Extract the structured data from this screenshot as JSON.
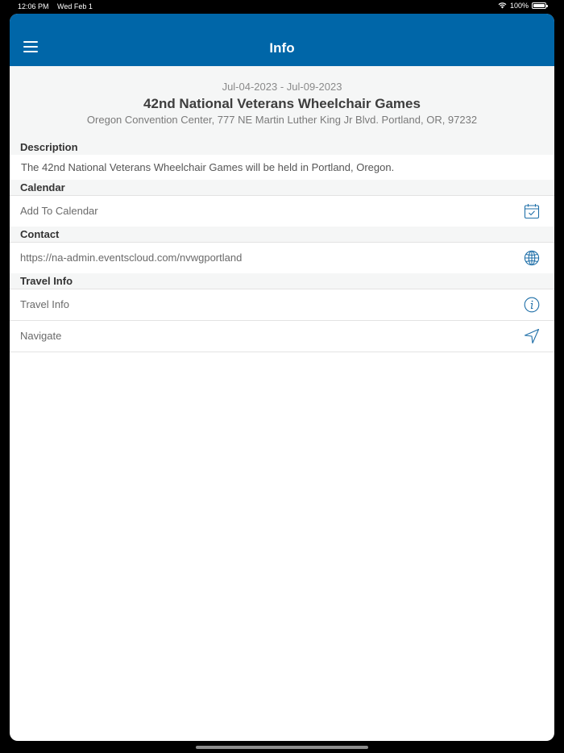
{
  "status_bar": {
    "time": "12:06 PM",
    "date": "Wed Feb 1",
    "battery": "100%"
  },
  "nav": {
    "title": "Info"
  },
  "event": {
    "dates": "Jul-04-2023 - Jul-09-2023",
    "title": "42nd National Veterans Wheelchair Games",
    "location": "Oregon Convention Center, 777 NE Martin Luther King Jr Blvd. Portland, OR, 97232"
  },
  "sections": {
    "description": {
      "header": "Description",
      "text": "The 42nd National Veterans Wheelchair Games will be held in Portland, Oregon."
    },
    "calendar": {
      "header": "Calendar",
      "add_label": "Add To Calendar"
    },
    "contact": {
      "header": "Contact",
      "url": "https://na-admin.eventscloud.com/nvwgportland"
    },
    "travel": {
      "header": "Travel Info",
      "travel_label": "Travel Info",
      "navigate_label": "Navigate"
    }
  },
  "icons": {
    "menu": "hamburger-menu-icon",
    "calendar": "calendar-check-icon",
    "globe": "globe-icon",
    "info": "info-icon",
    "navigate": "navigation-arrow-icon"
  },
  "colors": {
    "accent": "#0066a8",
    "section_bg": "#f5f6f6"
  }
}
